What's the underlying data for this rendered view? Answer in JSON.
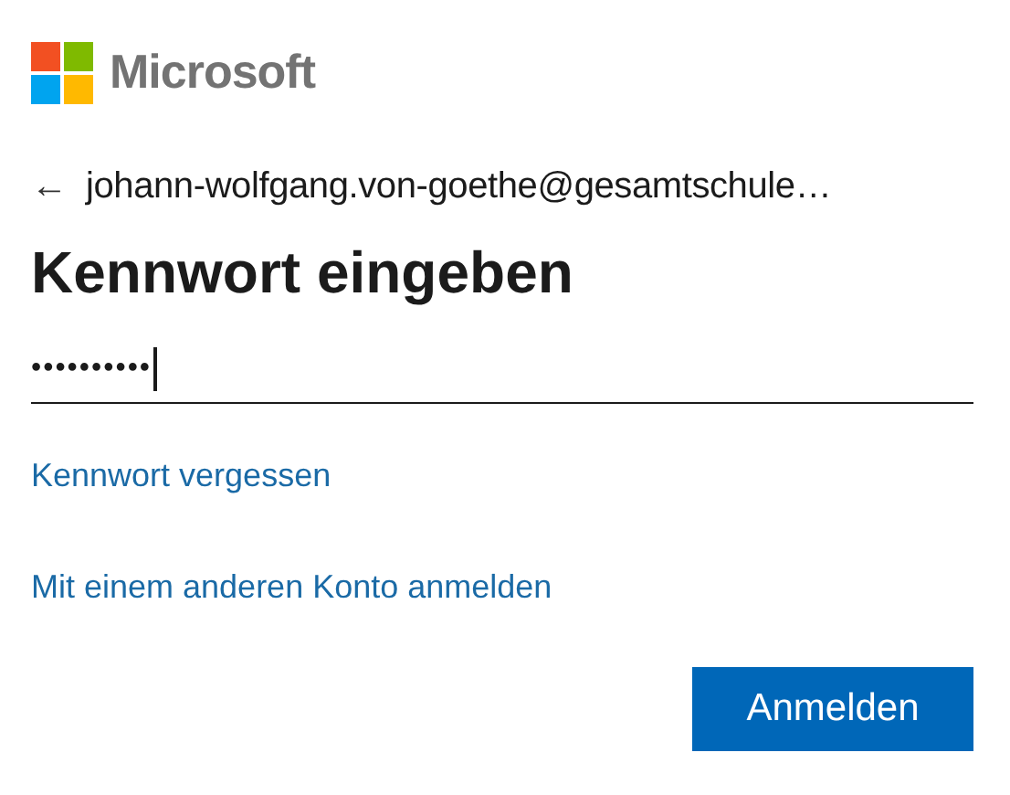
{
  "brand": {
    "name": "Microsoft"
  },
  "account": {
    "back": "←",
    "email": "johann-wolfgang.von-goethe@gesamtschule…"
  },
  "title": "Kennwort eingeben",
  "password_field": {
    "value": "••••••••••",
    "focused": true
  },
  "links": [
    "Kennwort vergessen",
    "Mit einem anderen Konto anmelden"
  ],
  "buttons": [
    "Anmelden"
  ]
}
